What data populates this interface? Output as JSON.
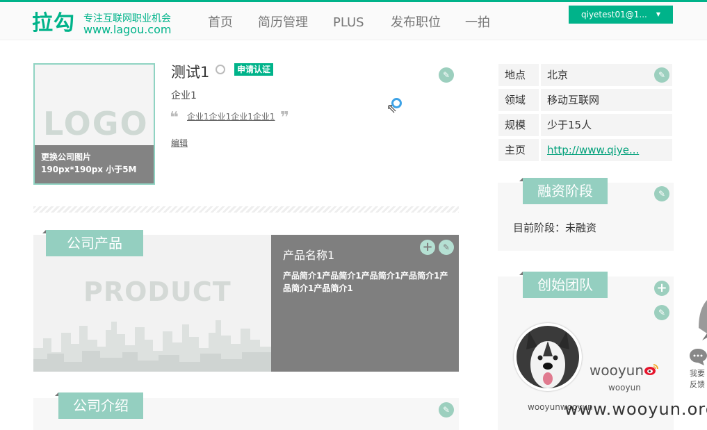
{
  "header": {
    "logo_text": "拉勾",
    "logo_slogan": "专注互联网职业机会",
    "logo_url": "www.lagou.com",
    "nav": [
      "首页",
      "简历管理",
      "PLUS",
      "发布职位",
      "一拍"
    ],
    "user": "qiyetest01@1..."
  },
  "company": {
    "logo_placeholder": "LOGO",
    "logo_hint_line1": "更换公司图片",
    "logo_hint_line2": "190px*190px 小于5M",
    "name": "测试1",
    "apply_cert": "申请认证",
    "short_name": "企业1",
    "slogan": "企业1企业1企业1企业1",
    "edit_label": "编辑"
  },
  "info": [
    {
      "label": "地点",
      "value": "北京"
    },
    {
      "label": "领域",
      "value": "移动互联网"
    },
    {
      "label": "规模",
      "value": "少于15人"
    },
    {
      "label": "主页",
      "value": "http://www.qiye..."
    }
  ],
  "products": {
    "section_title": "公司产品",
    "image_placeholder": "PRODUCT",
    "name": "产品名称1",
    "description": "产品简介1产品简介1产品简介1产品简介1产品简介1产品简介1"
  },
  "intro": {
    "section_title": "公司介绍"
  },
  "funding": {
    "section_title": "融资阶段",
    "text": "目前阶段：未融资"
  },
  "team": {
    "section_title": "创始团队",
    "member_name": "wooyun",
    "member_title": "wooyun",
    "member_desc": "wooyunwooyun"
  },
  "sidebar": {
    "feedback": "我要反馈"
  },
  "watermark": "www.wooyun.org",
  "colors": {
    "accent": "#00b38a",
    "section_title_bg": "#94cfc0",
    "product_panel_bg": "#7f7f7f"
  }
}
